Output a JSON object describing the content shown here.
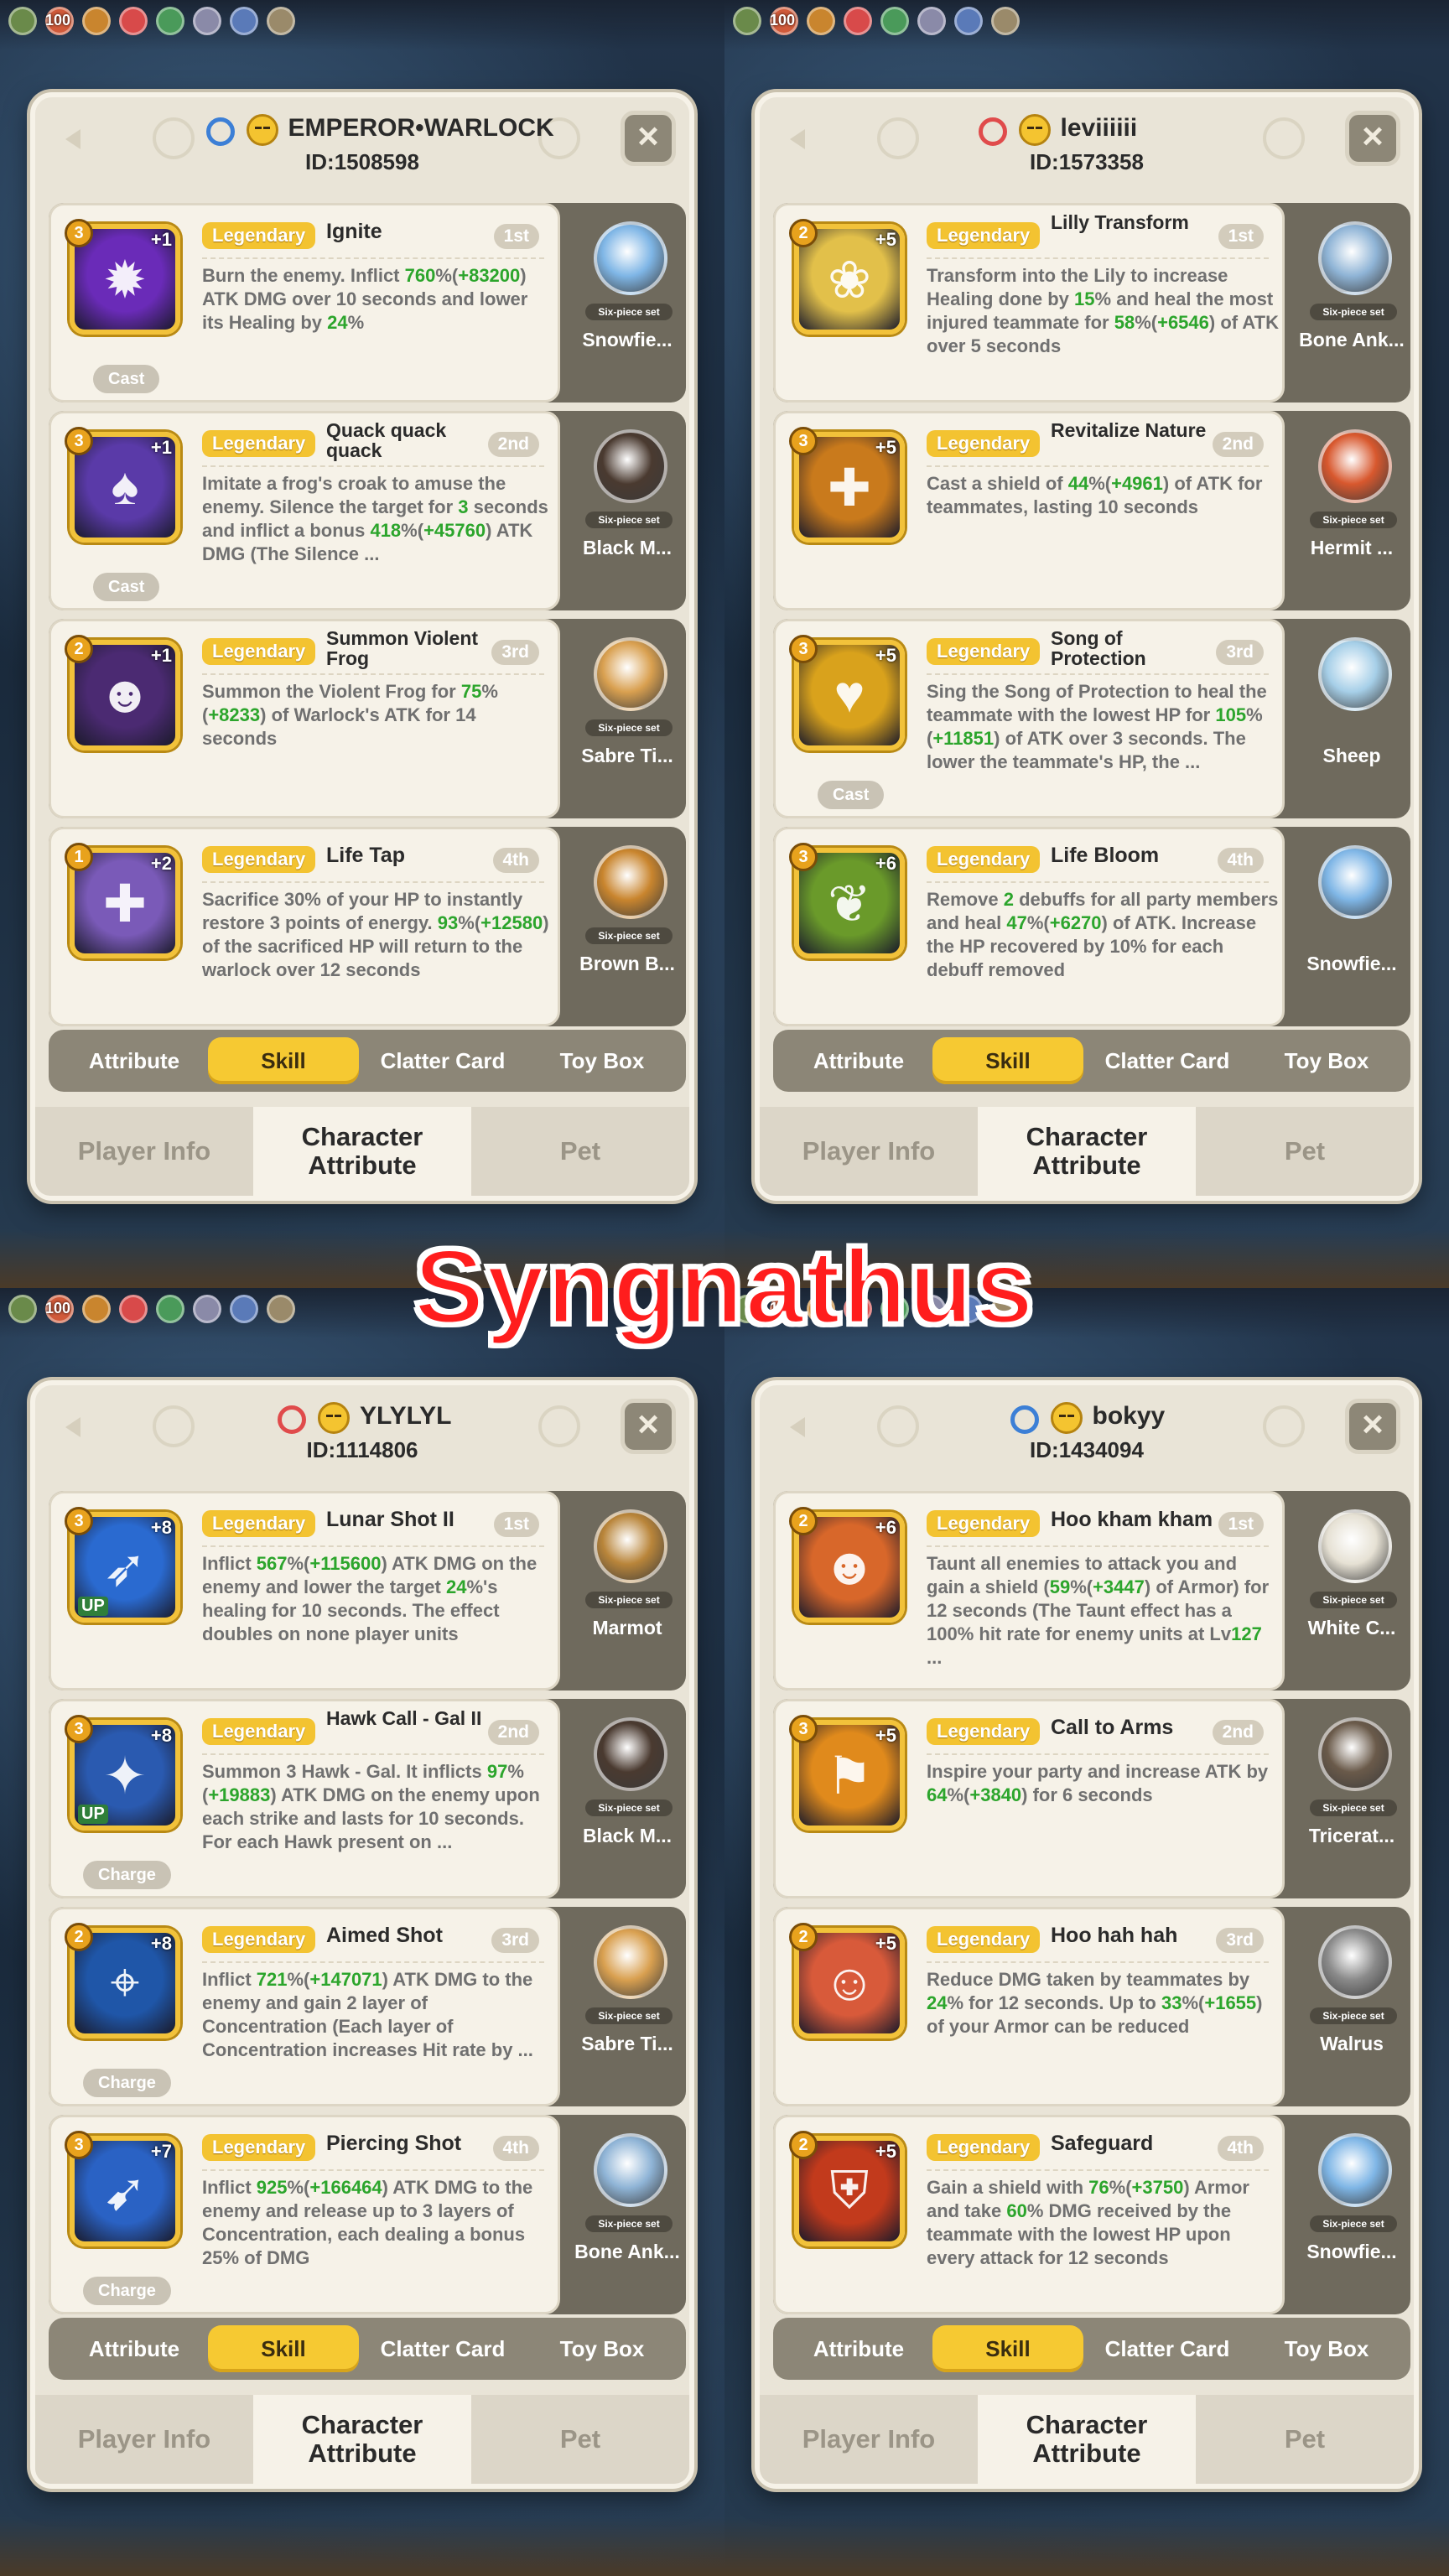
{
  "banner": {
    "title": "Syngnathus"
  },
  "hud": {
    "top_counter": "100"
  },
  "panels": [
    {
      "gender": "male",
      "name": "EMPEROR•WARLOCK",
      "id_text": "ID:1508598",
      "close_label": "×",
      "skills": [
        {
          "rarity": "Legendary",
          "name": "Ignite",
          "order": "1st",
          "level": "3",
          "plus": "+1",
          "tag": "Cast",
          "up": "",
          "icon_color": "#6a2bb8",
          "icon_symbol": "✹",
          "desc": [
            {
              "t": "Burn the enemy. Inflict "
            },
            {
              "t": "760",
              "g": true
            },
            {
              "t": "%("
            },
            {
              "t": "+83200",
              "g": true
            },
            {
              "t": ") ATK DMG over 10 seconds and lower its Healing by "
            },
            {
              "t": "24",
              "g": true
            },
            {
              "t": "%"
            }
          ],
          "pet": {
            "name": "Snowfie...",
            "set": "Six-piece set",
            "color": "#7fb6e6"
          }
        },
        {
          "rarity": "Legendary",
          "name": "Quack quack quack",
          "order": "2nd",
          "level": "3",
          "plus": "+1",
          "tag": "Cast",
          "up": "",
          "icon_color": "#5a3aa8",
          "icon_symbol": "♠",
          "desc": [
            {
              "t": "Imitate a frog's croak to amuse the enemy. Silence the target for "
            },
            {
              "t": "3",
              "g": true
            },
            {
              "t": " seconds and inflict a bonus "
            },
            {
              "t": "418",
              "g": true
            },
            {
              "t": "%("
            },
            {
              "t": "+45760",
              "g": true
            },
            {
              "t": ") ATK DMG (The Silence ..."
            }
          ],
          "pet": {
            "name": "Black M...",
            "set": "Six-piece set",
            "color": "#4a3a30"
          }
        },
        {
          "rarity": "Legendary",
          "name": "Summon Violent Frog",
          "order": "3rd",
          "level": "2",
          "plus": "+1",
          "tag": "",
          "up": "",
          "icon_color": "#4b2a72",
          "icon_symbol": "☻",
          "desc": [
            {
              "t": "Summon the Violent Frog for "
            },
            {
              "t": "75",
              "g": true
            },
            {
              "t": "%("
            },
            {
              "t": "+8233",
              "g": true
            },
            {
              "t": ") of Warlock's ATK for 14 seconds"
            }
          ],
          "pet": {
            "name": "Sabre Ti...",
            "set": "Six-piece set",
            "color": "#d9a050"
          }
        },
        {
          "rarity": "Legendary",
          "name": "Life Tap",
          "order": "4th",
          "level": "1",
          "plus": "+2",
          "tag": "",
          "up": "",
          "icon_color": "#7a5ab8",
          "icon_symbol": "✚",
          "desc": [
            {
              "t": "Sacrifice 30% of your HP to instantly restore 3 points of energy. "
            },
            {
              "t": "93",
              "g": true
            },
            {
              "t": "%("
            },
            {
              "t": "+12580",
              "g": true
            },
            {
              "t": ") of the sacrificed HP will return to the warlock over 12 seconds"
            }
          ],
          "pet": {
            "name": "Brown B...",
            "set": "Six-piece set",
            "color": "#c9852e"
          }
        }
      ],
      "sub_tabs": [
        "Attribute",
        "Skill",
        "Clatter Card",
        "Toy Box"
      ],
      "active_sub_tab": "Skill",
      "main_tabs": [
        "Player Info",
        "Character Attribute",
        "Pet"
      ]
    },
    {
      "gender": "female",
      "name": "leviiiiii",
      "id_text": "ID:1573358",
      "close_label": "×",
      "skills": [
        {
          "rarity": "Legendary",
          "name": "Lilly Transform",
          "order": "1st",
          "level": "2",
          "plus": "+5",
          "tag": "",
          "up": "",
          "icon_color": "#e2c04a",
          "icon_symbol": "❀",
          "desc": [
            {
              "t": "Transform into the Lily to increase Healing done by "
            },
            {
              "t": "15",
              "g": true
            },
            {
              "t": "% and heal the most injured teammate for "
            },
            {
              "t": "58",
              "g": true
            },
            {
              "t": "%("
            },
            {
              "t": "+6546",
              "g": true
            },
            {
              "t": ") of ATK over 5 seconds"
            }
          ],
          "pet": {
            "name": "Bone Ank...",
            "set": "Six-piece set",
            "color": "#8fb4d6"
          }
        },
        {
          "rarity": "Legendary",
          "name": "Revitalize Nature",
          "order": "2nd",
          "level": "3",
          "plus": "+5",
          "tag": "",
          "up": "",
          "icon_color": "#c97a1c",
          "icon_symbol": "✚",
          "desc": [
            {
              "t": "Cast a shield of "
            },
            {
              "t": "44",
              "g": true
            },
            {
              "t": "%("
            },
            {
              "t": "+4961",
              "g": true
            },
            {
              "t": ") of ATK for teammates, lasting 10 seconds"
            }
          ],
          "pet": {
            "name": "Hermit ...",
            "set": "Six-piece set",
            "color": "#d8582e"
          }
        },
        {
          "rarity": "Legendary",
          "name": "Song of Protection",
          "order": "3rd",
          "level": "3",
          "plus": "+5",
          "tag": "Cast",
          "up": "",
          "icon_color": "#d9a21c",
          "icon_symbol": "♥",
          "desc": [
            {
              "t": "Sing the Song of Protection to heal the teammate with the lowest HP for "
            },
            {
              "t": "105",
              "g": true
            },
            {
              "t": "%("
            },
            {
              "t": "+11851",
              "g": true
            },
            {
              "t": ") of ATK over 3 seconds. The lower the teammate's HP, the ..."
            }
          ],
          "pet": {
            "name": "Sheep",
            "set": "",
            "color": "#a6cfe8"
          }
        },
        {
          "rarity": "Legendary",
          "name": "Life Bloom",
          "order": "4th",
          "level": "3",
          "plus": "+6",
          "tag": "",
          "up": "",
          "icon_color": "#6a9a2a",
          "icon_symbol": "❦",
          "desc": [
            {
              "t": "Remove "
            },
            {
              "t": "2",
              "g": true
            },
            {
              "t": " debuffs for all party members and heal "
            },
            {
              "t": "47",
              "g": true
            },
            {
              "t": "%("
            },
            {
              "t": "+6270",
              "g": true
            },
            {
              "t": ") of ATK. Increase the HP recovered by 10% for each debuff removed"
            }
          ],
          "pet": {
            "name": "Snowfie...",
            "set": "",
            "color": "#7fb6e6"
          }
        }
      ],
      "sub_tabs": [
        "Attribute",
        "Skill",
        "Clatter Card",
        "Toy Box"
      ],
      "active_sub_tab": "Skill",
      "main_tabs": [
        "Player Info",
        "Character Attribute",
        "Pet"
      ]
    },
    {
      "gender": "female",
      "name": "YLYLYL",
      "id_text": "ID:1114806",
      "close_label": "×",
      "skills": [
        {
          "rarity": "Legendary",
          "name": "Lunar Shot II",
          "order": "1st",
          "level": "3",
          "plus": "+8",
          "tag": "",
          "up": "UP",
          "icon_color": "#2a6ad0",
          "icon_symbol": "➶",
          "desc": [
            {
              "t": "Inflict "
            },
            {
              "t": "567",
              "g": true
            },
            {
              "t": "%("
            },
            {
              "t": "+115600",
              "g": true
            },
            {
              "t": ") ATK DMG on the enemy and lower the target "
            },
            {
              "t": "24",
              "g": true
            },
            {
              "t": "%'s healing for 10 seconds. The effect doubles on none player units"
            }
          ],
          "pet": {
            "name": "Marmot",
            "set": "Six-piece set",
            "color": "#b9853a"
          }
        },
        {
          "rarity": "Legendary",
          "name": "Hawk Call - Gal II",
          "order": "2nd",
          "level": "3",
          "plus": "+8",
          "tag": "Charge",
          "up": "UP",
          "icon_color": "#2a5ab0",
          "icon_symbol": "✦",
          "desc": [
            {
              "t": "Summon 3 Hawk - Gal. It inflicts "
            },
            {
              "t": "97",
              "g": true
            },
            {
              "t": "%("
            },
            {
              "t": "+19883",
              "g": true
            },
            {
              "t": ") ATK DMG on the enemy upon each strike and lasts for 10 seconds. For each Hawk present on ..."
            }
          ],
          "pet": {
            "name": "Black M...",
            "set": "Six-piece set",
            "color": "#4a3a30"
          }
        },
        {
          "rarity": "Legendary",
          "name": "Aimed Shot",
          "order": "3rd",
          "level": "2",
          "plus": "+8",
          "tag": "Charge",
          "up": "",
          "icon_color": "#1f56a8",
          "icon_symbol": "⌖",
          "desc": [
            {
              "t": "Inflict "
            },
            {
              "t": "721",
              "g": true
            },
            {
              "t": "%("
            },
            {
              "t": "+147071",
              "g": true
            },
            {
              "t": ") ATK DMG to the enemy and gain 2 layer of Concentration (Each layer of Concentration increases Hit rate by ..."
            }
          ],
          "pet": {
            "name": "Sabre Ti...",
            "set": "Six-piece set",
            "color": "#d9a050"
          }
        },
        {
          "rarity": "Legendary",
          "name": "Piercing Shot",
          "order": "4th",
          "level": "3",
          "plus": "+7",
          "tag": "Charge",
          "up": "",
          "icon_color": "#2a62c4",
          "icon_symbol": "➹",
          "desc": [
            {
              "t": "Inflict "
            },
            {
              "t": "925",
              "g": true
            },
            {
              "t": "%("
            },
            {
              "t": "+166464",
              "g": true
            },
            {
              "t": ") ATK DMG to the enemy and release up to 3 layers of Concentration, each dealing a bonus 25% of DMG"
            }
          ],
          "pet": {
            "name": "Bone Ank...",
            "set": "Six-piece set",
            "color": "#8fb4d6"
          }
        }
      ],
      "sub_tabs": [
        "Attribute",
        "Skill",
        "Clatter Card",
        "Toy Box"
      ],
      "active_sub_tab": "Skill",
      "main_tabs": [
        "Player Info",
        "Character Attribute",
        "Pet"
      ]
    },
    {
      "gender": "male",
      "name": "bokyy",
      "id_text": "ID:1434094",
      "close_label": "×",
      "skills": [
        {
          "rarity": "Legendary",
          "name": "Hoo kham kham",
          "order": "1st",
          "level": "2",
          "plus": "+6",
          "tag": "",
          "up": "",
          "icon_color": "#d8672a",
          "icon_symbol": "☻",
          "desc": [
            {
              "t": "Taunt all enemies to attack you and gain a shield ("
            },
            {
              "t": "59",
              "g": true
            },
            {
              "t": "%("
            },
            {
              "t": "+3447",
              "g": true
            },
            {
              "t": ") of Armor) for 12 seconds (The Taunt effect has a 100% hit rate for enemy units at Lv"
            },
            {
              "t": "127",
              "g": true
            },
            {
              "t": " ..."
            }
          ],
          "pet": {
            "name": "White C...",
            "set": "Six-piece set",
            "color": "#e6e1d4"
          }
        },
        {
          "rarity": "Legendary",
          "name": "Call to Arms",
          "order": "2nd",
          "level": "3",
          "plus": "+5",
          "tag": "",
          "up": "",
          "icon_color": "#e08a1c",
          "icon_symbol": "⚑",
          "desc": [
            {
              "t": "Inspire your party and increase ATK by "
            },
            {
              "t": "64",
              "g": true
            },
            {
              "t": "%("
            },
            {
              "t": "+3840",
              "g": true
            },
            {
              "t": ") for 6 seconds"
            }
          ],
          "pet": {
            "name": "Tricerat...",
            "set": "Six-piece set",
            "color": "#6a5a4a"
          }
        },
        {
          "rarity": "Legendary",
          "name": "Hoo hah hah",
          "order": "3rd",
          "level": "2",
          "plus": "+5",
          "tag": "",
          "up": "",
          "icon_color": "#d85a3a",
          "icon_symbol": "☺",
          "desc": [
            {
              "t": "Reduce DMG taken by teammates by "
            },
            {
              "t": "24",
              "g": true
            },
            {
              "t": "% for 12 seconds. Up to "
            },
            {
              "t": "33",
              "g": true
            },
            {
              "t": "%("
            },
            {
              "t": "+1655",
              "g": true
            },
            {
              "t": ") of your Armor can be reduced"
            }
          ],
          "pet": {
            "name": "Walrus",
            "set": "Six-piece set",
            "color": "#8a8a8a"
          }
        },
        {
          "rarity": "Legendary",
          "name": "Safeguard",
          "order": "4th",
          "level": "2",
          "plus": "+5",
          "tag": "",
          "up": "",
          "icon_color": "#c23a1c",
          "icon_symbol": "⛨",
          "desc": [
            {
              "t": "Gain a shield with "
            },
            {
              "t": "76",
              "g": true
            },
            {
              "t": "%("
            },
            {
              "t": "+3750",
              "g": true
            },
            {
              "t": ") Armor and take "
            },
            {
              "t": "60",
              "g": true
            },
            {
              "t": "% DMG received by the teammate with the lowest HP upon every attack for 12 seconds"
            }
          ],
          "pet": {
            "name": "Snowfie...",
            "set": "Six-piece set",
            "color": "#7fb6e6"
          }
        }
      ],
      "sub_tabs": [
        "Attribute",
        "Skill",
        "Clatter Card",
        "Toy Box"
      ],
      "active_sub_tab": "Skill",
      "main_tabs": [
        "Player Info",
        "Character Attribute",
        "Pet"
      ]
    }
  ]
}
